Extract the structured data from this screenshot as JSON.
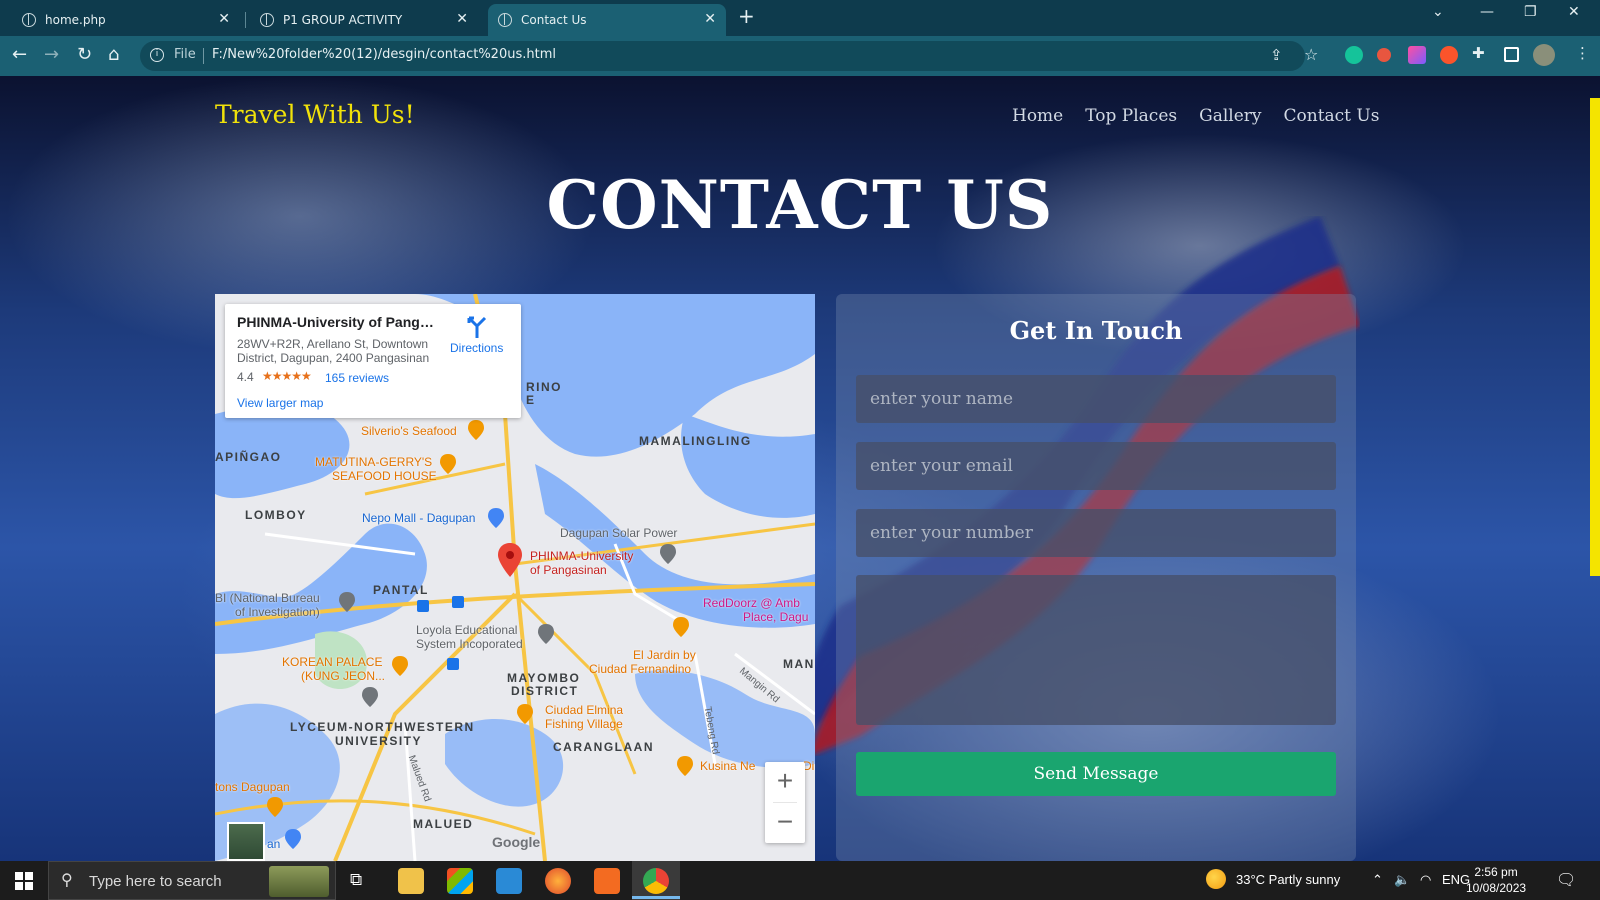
{
  "browser": {
    "tabs": [
      {
        "title": "home.php",
        "active": false
      },
      {
        "title": "P1 GROUP ACTIVITY",
        "active": false
      },
      {
        "title": "Contact Us",
        "active": true
      }
    ],
    "address": {
      "scheme_label": "File",
      "url": "F:/New%20folder%20(12)/desgin/contact%20us.html"
    }
  },
  "site": {
    "brand": "Travel With Us!",
    "nav": [
      "Home",
      "Top Places",
      "Gallery",
      "Contact Us"
    ],
    "hero_title": "CONTACT US"
  },
  "map": {
    "card": {
      "place": "PHINMA-University of Pangas...",
      "address": "28WV+R2R, Arellano St, Downtown District, Dagupan, 2400 Pangasinan",
      "rating": "4.4",
      "stars": "★★★★★",
      "reviews": "165 reviews",
      "larger_map": "View larger map",
      "directions": "Directions"
    },
    "labels": {
      "silverios": "Silverio's Seafood",
      "matutina1": "MATUTINA-GERRY'S",
      "matutina2": "SEAFOOD HOUSE",
      "apinao": "APIÑGAO",
      "rino1": "RINO",
      "rino2": "E",
      "mamalingling": "MAMALINGLING",
      "lomboy": "LOMBOY",
      "nepo": "Nepo Mall - Dagupan",
      "solar": "Dagupan Solar Power",
      "phinma1": "PHINMA-University",
      "phinma2": "of Pangasinan",
      "pantal": "PANTAL",
      "nbi1": "BI (National Bureau",
      "nbi2": "of Investigation)",
      "reddoorz1": "RedDoorz @ Amb",
      "reddoorz2": "Place, Dagu",
      "loyola1": "Loyola Educational",
      "loyola2": "System Incoporated",
      "jardin1": "El Jardin by",
      "jardin2": "Ciudad Fernandino",
      "man": "MAN",
      "korean1": "KOREAN PALACE",
      "korean2": "(KUNG JEON...",
      "mayombo1": "MAYOMBO",
      "mayombo2": "DISTRICT",
      "elmina1": "Ciudad Elmina",
      "elmina2": "Fishing Village",
      "lyceum1": "LYCEUM-NORTHWESTERN",
      "lyceum2": "UNIVERSITY",
      "caranglaan": "CARANGLAAN",
      "kusina": "Kusina Ne",
      "di": "Di",
      "tons": "tons Dagupan",
      "an": "an",
      "malued": "MALUED",
      "malued_rd": "Malued Rd",
      "tebeng": "Tebeng Rd",
      "mangin": "Mangin Rd"
    },
    "zoom_in": "+",
    "zoom_out": "−",
    "logo": "Google"
  },
  "form": {
    "title": "Get In Touch",
    "name_placeholder": "enter your name",
    "email_placeholder": "enter your email",
    "number_placeholder": "enter your number",
    "message_placeholder": "",
    "submit": "Send Message"
  },
  "taskbar": {
    "search_placeholder": "Type here to search",
    "weather": "33°C  Partly sunny",
    "lang": "ENG",
    "time": "2:56 pm",
    "date": "10/08/2023"
  }
}
